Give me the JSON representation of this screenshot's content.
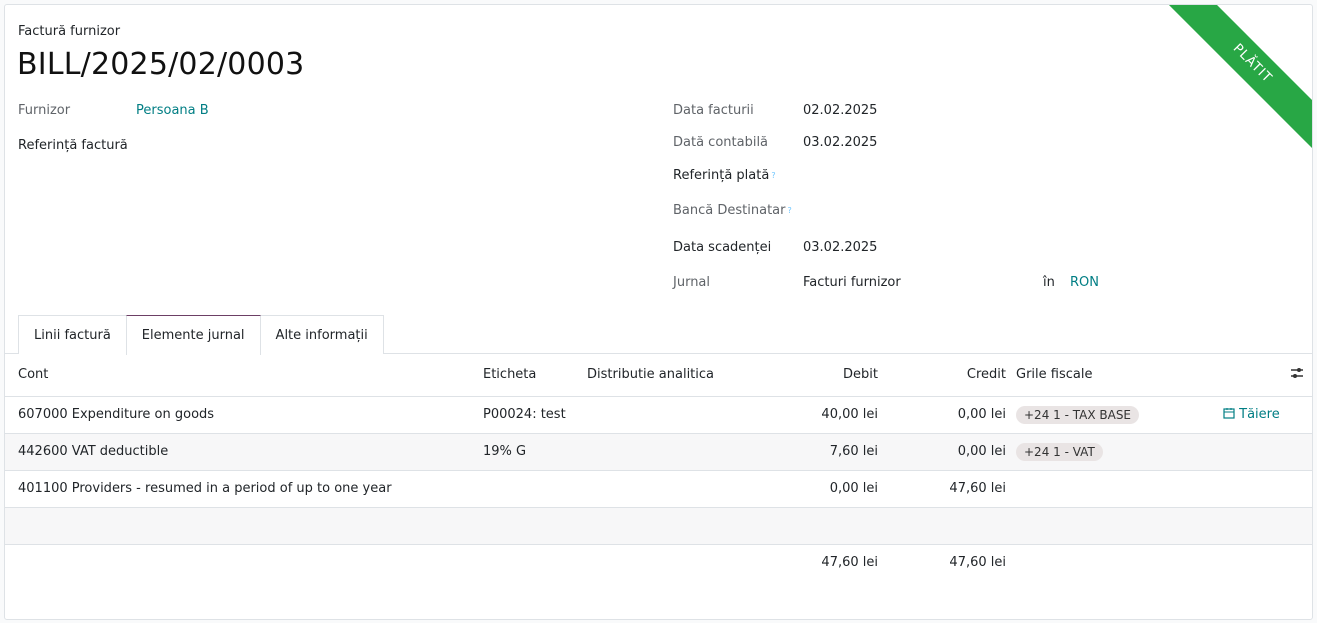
{
  "status_ribbon": "PLĂTIT",
  "header": {
    "doc_type": "Factură furnizor",
    "doc_name": "BILL/2025/02/0003"
  },
  "left_fields": {
    "vendor_label": "Furnizor",
    "vendor_value": "Persoana B",
    "ref_label": "Referință factură"
  },
  "right_fields": {
    "invoice_date_label": "Data facturii",
    "invoice_date_value": "02.02.2025",
    "accounting_date_label": "Dată contabilă",
    "accounting_date_value": "03.02.2025",
    "payment_ref_label": "Referință plată",
    "bank_label": "Bancă Destinatar",
    "due_date_label": "Data scadenței",
    "due_date_value": "03.02.2025",
    "journal_label": "Jurnal",
    "journal_value": "Facturi furnizor",
    "currency_in": "în",
    "currency_value": "RON",
    "help_mark": "?"
  },
  "tabs": [
    {
      "label": "Linii factură"
    },
    {
      "label": "Elemente jurnal"
    },
    {
      "label": "Alte informații"
    }
  ],
  "table": {
    "headers": {
      "account": "Cont",
      "label": "Eticheta",
      "analytic": "Distributie analitica",
      "debit": "Debit",
      "credit": "Credit",
      "tax_grids": "Grile fiscale"
    },
    "rows": [
      {
        "account": "607000 Expenditure on goods",
        "label": "P00024: test",
        "debit": "40,00 lei",
        "credit": "0,00 lei",
        "tax_grid": "+24 1 - TAX BASE",
        "action": "Tăiere"
      },
      {
        "account": "442600 VAT deductible",
        "label": "19% G",
        "debit": "7,60 lei",
        "credit": "0,00 lei",
        "tax_grid": "+24 1 - VAT",
        "action": ""
      },
      {
        "account": "401100 Providers - resumed in a period of up to one year",
        "label": "",
        "debit": "0,00 lei",
        "credit": "47,60 lei",
        "tax_grid": "",
        "action": ""
      }
    ],
    "total_debit": "47,60 lei",
    "total_credit": "47,60 lei"
  },
  "colors": {
    "accent": "#017e84",
    "ribbon": "#28a745",
    "tab_active": "#6c3f65"
  }
}
